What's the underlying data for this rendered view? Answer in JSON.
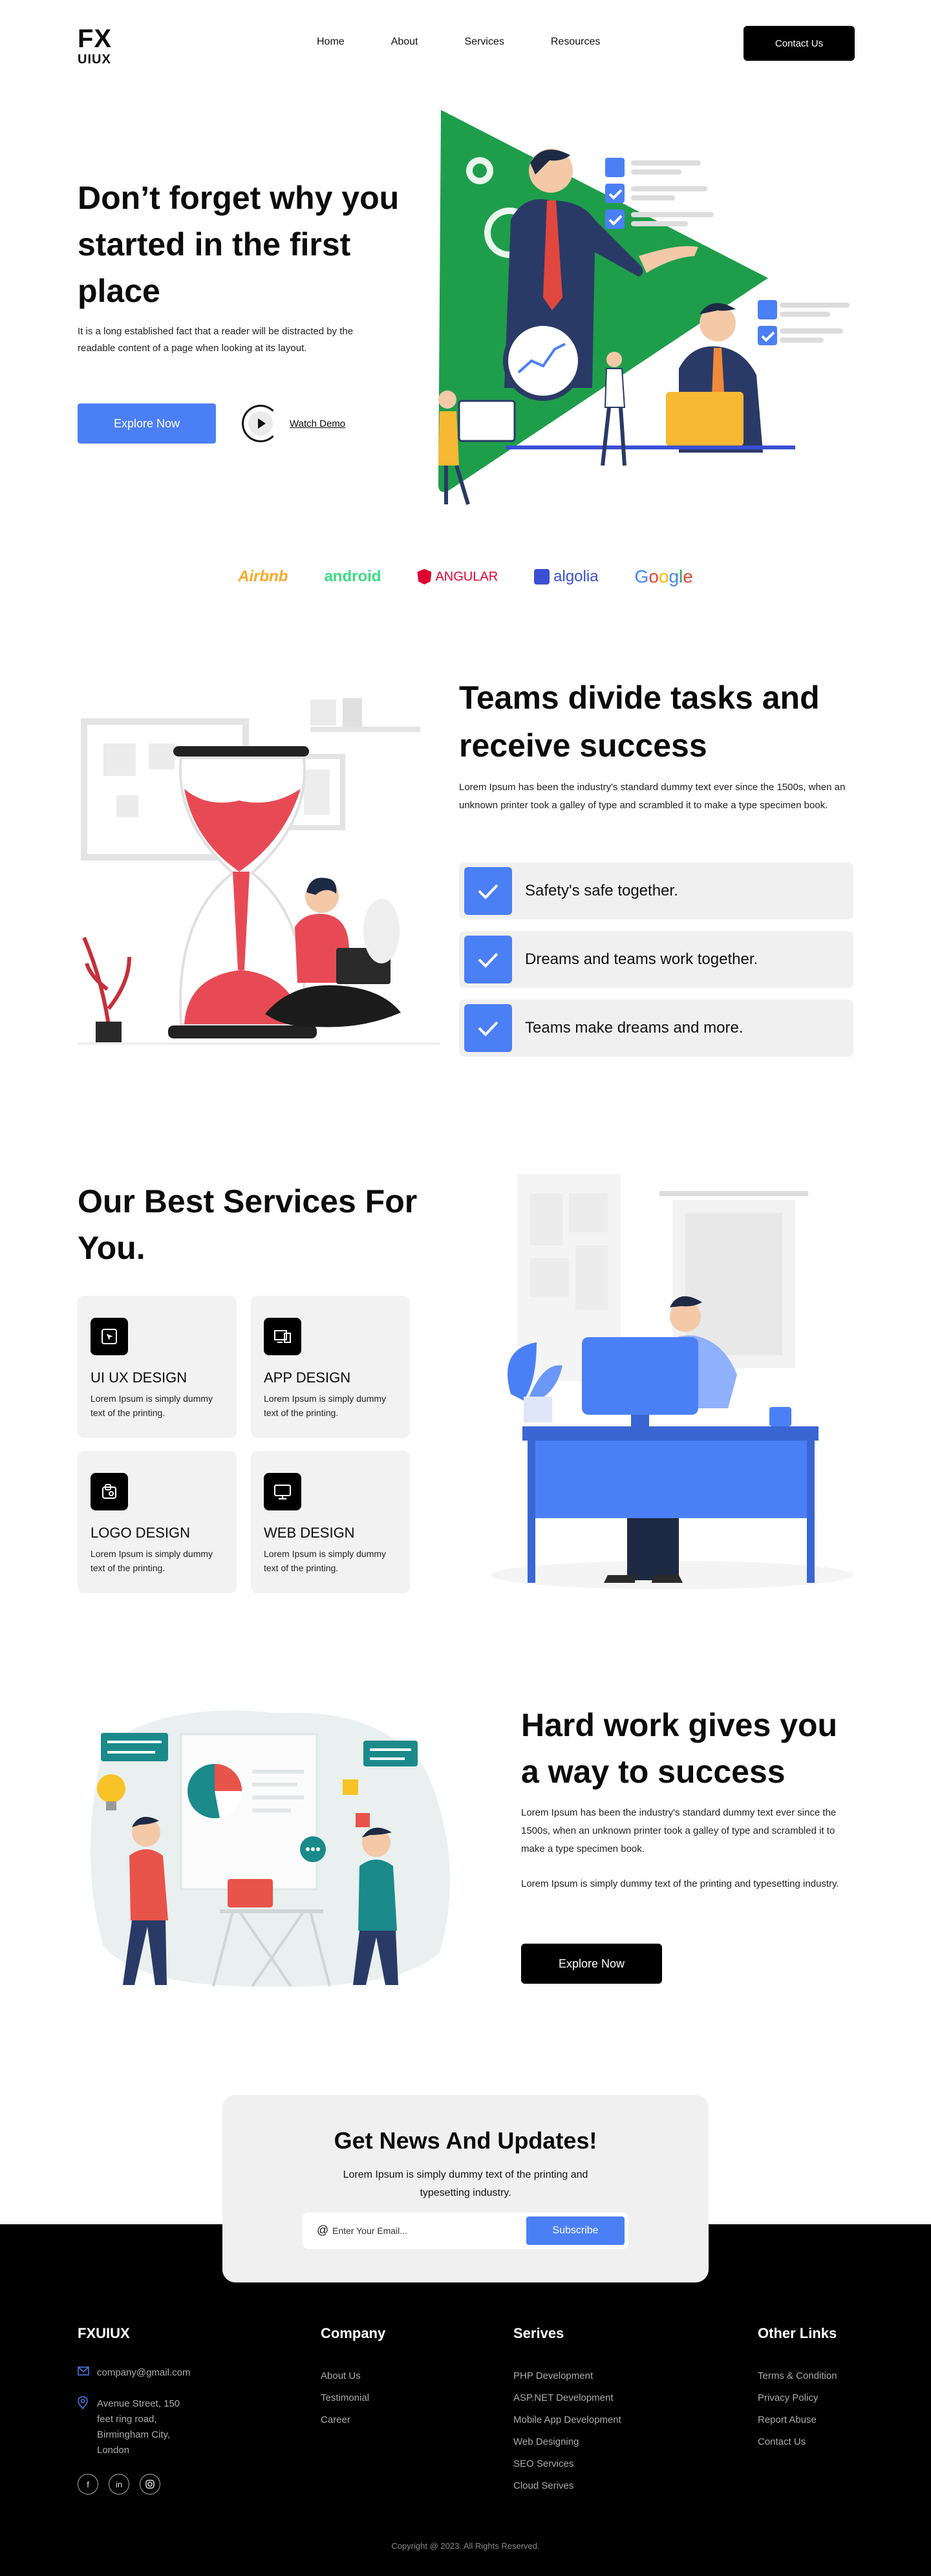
{
  "nav": {
    "logo_line1": "FX",
    "logo_line2": "UIUX",
    "links": [
      "Home",
      "About",
      "Services",
      "Resources"
    ],
    "contact_label": "Contact Us"
  },
  "hero": {
    "title": "Don’t forget why you started in the first place",
    "text": "It is a long established fact that a reader will be distracted by the readable content of a page when looking at its layout.",
    "cta_label": "Explore Now",
    "watch_label": "Watch Demo",
    "accent_green": "#1e9e4a"
  },
  "brands": [
    "Airbnb",
    "android",
    "ANGULAR",
    "algolia",
    "Google"
  ],
  "teams": {
    "title": "Teams divide tasks and receive success",
    "text": "Lorem Ipsum has been the industry's standard dummy text ever since the 1500s, when an unknown printer took a galley of type and scrambled it to make a type specimen book.",
    "items": [
      "Safety's safe together.",
      "Dreams and teams work together.",
      "Teams make dreams and more."
    ]
  },
  "services": {
    "title": "Our Best Services For You.",
    "cards": [
      {
        "name": "UI UX DESIGN",
        "text": "Lorem Ipsum is simply dummy text of the printing.",
        "icon": "cursor-icon"
      },
      {
        "name": "APP DESIGN",
        "text": "Lorem Ipsum is simply dummy text of the printing.",
        "icon": "app-icon"
      },
      {
        "name": "LOGO DESIGN",
        "text": "Lorem Ipsum is simply dummy text of the printing.",
        "icon": "logo-icon"
      },
      {
        "name": "WEB DESIGN",
        "text": "Lorem Ipsum is simply dummy text of the printing.",
        "icon": "monitor-icon"
      }
    ]
  },
  "hardwork": {
    "title": "Hard work gives you a way to success",
    "text1": "Lorem Ipsum has been the industry's standard dummy text ever since the 1500s, when an unknown printer took a galley of type and scrambled it to make a type specimen book.",
    "text2": "Lorem Ipsum is simply dummy text of the printing and typesetting industry.",
    "cta_label": "Explore Now"
  },
  "newsletter": {
    "title": "Get News And Updates!",
    "text": "Lorem Ipsum is simply dummy text of the printing and typesetting industry.",
    "placeholder": "Enter Your Email...",
    "button_label": "Subscribe"
  },
  "footer": {
    "brand": "FXUIUX",
    "email": "company@gmail.com",
    "address": "Avenue Street, 150 feet ring road, Birmingham City, London",
    "social": [
      "f",
      "in",
      "ig"
    ],
    "company": {
      "title": "Company",
      "links": [
        "About Us",
        "Testimonial",
        "Career"
      ]
    },
    "services": {
      "title": "Serives",
      "links": [
        "PHP Development",
        "ASP.NET Development",
        "Mobile App Development",
        "Web Designing",
        "SEO Services",
        "Cloud Serives"
      ]
    },
    "other": {
      "title": "Other Links",
      "links": [
        "Terms & Condition",
        "Privacy Policy",
        "Report Abuse",
        "Contact Us"
      ]
    },
    "copyright": "Copyright @ 2023. All Rights Reserved."
  },
  "colors": {
    "primary": "#4b7ff5",
    "dark": "#000000",
    "panel": "#f0f0f0",
    "hero_green": "#1e9e4a",
    "hourglass_red": "#e84a55"
  }
}
